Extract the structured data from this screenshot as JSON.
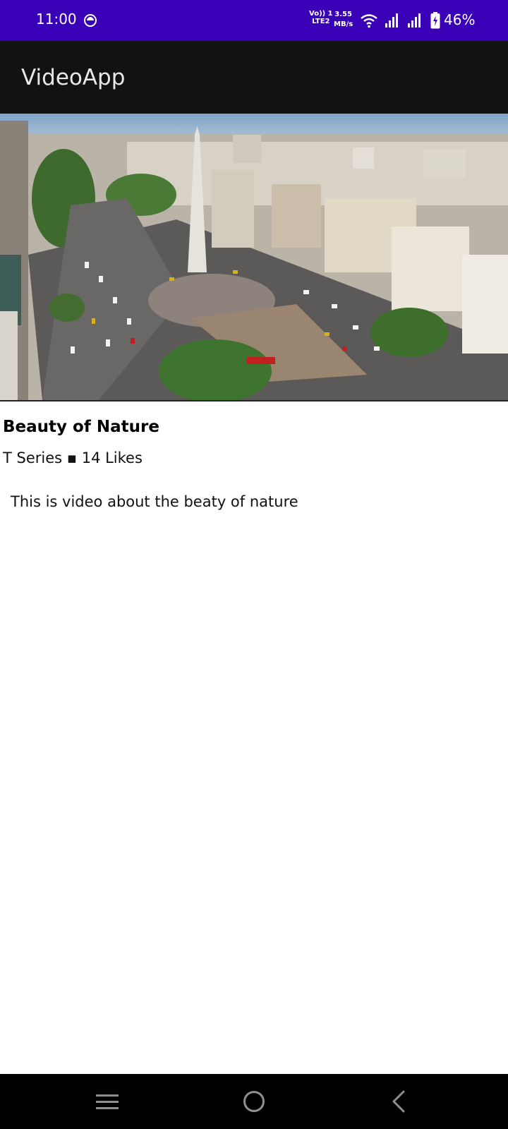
{
  "status_bar": {
    "time": "11:00",
    "network_line1": "Vo)) 1",
    "network_line2": "LTE2",
    "speed_value": "3.55",
    "speed_unit": "MB/s",
    "battery_percent": "46%"
  },
  "app_bar": {
    "title": "VideoApp"
  },
  "video": {
    "title": "Beauty of Nature",
    "channel": "T Series",
    "separator": "▪",
    "likes": "14 Likes",
    "description": "This is video about the beaty of nature"
  },
  "nav": {
    "menu_icon": "menu-icon",
    "home_icon": "home-icon",
    "back_icon": "back-icon"
  },
  "colors": {
    "status_bar": "#3a00b8",
    "app_bar": "#121212",
    "nav_bar": "#000000"
  }
}
